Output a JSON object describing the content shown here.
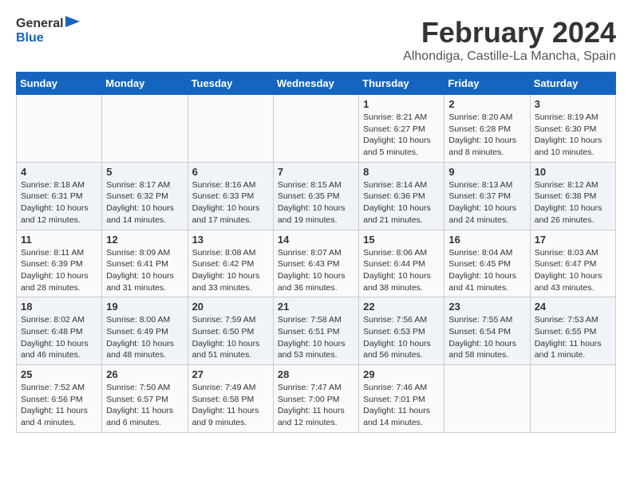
{
  "header": {
    "logo_line1": "General",
    "logo_line2": "Blue",
    "month": "February 2024",
    "location": "Alhondiga, Castille-La Mancha, Spain"
  },
  "days_of_week": [
    "Sunday",
    "Monday",
    "Tuesday",
    "Wednesday",
    "Thursday",
    "Friday",
    "Saturday"
  ],
  "weeks": [
    [
      {
        "day": "",
        "detail": ""
      },
      {
        "day": "",
        "detail": ""
      },
      {
        "day": "",
        "detail": ""
      },
      {
        "day": "",
        "detail": ""
      },
      {
        "day": "1",
        "detail": "Sunrise: 8:21 AM\nSunset: 6:27 PM\nDaylight: 10 hours\nand 5 minutes."
      },
      {
        "day": "2",
        "detail": "Sunrise: 8:20 AM\nSunset: 6:28 PM\nDaylight: 10 hours\nand 8 minutes."
      },
      {
        "day": "3",
        "detail": "Sunrise: 8:19 AM\nSunset: 6:30 PM\nDaylight: 10 hours\nand 10 minutes."
      }
    ],
    [
      {
        "day": "4",
        "detail": "Sunrise: 8:18 AM\nSunset: 6:31 PM\nDaylight: 10 hours\nand 12 minutes."
      },
      {
        "day": "5",
        "detail": "Sunrise: 8:17 AM\nSunset: 6:32 PM\nDaylight: 10 hours\nand 14 minutes."
      },
      {
        "day": "6",
        "detail": "Sunrise: 8:16 AM\nSunset: 6:33 PM\nDaylight: 10 hours\nand 17 minutes."
      },
      {
        "day": "7",
        "detail": "Sunrise: 8:15 AM\nSunset: 6:35 PM\nDaylight: 10 hours\nand 19 minutes."
      },
      {
        "day": "8",
        "detail": "Sunrise: 8:14 AM\nSunset: 6:36 PM\nDaylight: 10 hours\nand 21 minutes."
      },
      {
        "day": "9",
        "detail": "Sunrise: 8:13 AM\nSunset: 6:37 PM\nDaylight: 10 hours\nand 24 minutes."
      },
      {
        "day": "10",
        "detail": "Sunrise: 8:12 AM\nSunset: 6:38 PM\nDaylight: 10 hours\nand 26 minutes."
      }
    ],
    [
      {
        "day": "11",
        "detail": "Sunrise: 8:11 AM\nSunset: 6:39 PM\nDaylight: 10 hours\nand 28 minutes."
      },
      {
        "day": "12",
        "detail": "Sunrise: 8:09 AM\nSunset: 6:41 PM\nDaylight: 10 hours\nand 31 minutes."
      },
      {
        "day": "13",
        "detail": "Sunrise: 8:08 AM\nSunset: 6:42 PM\nDaylight: 10 hours\nand 33 minutes."
      },
      {
        "day": "14",
        "detail": "Sunrise: 8:07 AM\nSunset: 6:43 PM\nDaylight: 10 hours\nand 36 minutes."
      },
      {
        "day": "15",
        "detail": "Sunrise: 8:06 AM\nSunset: 6:44 PM\nDaylight: 10 hours\nand 38 minutes."
      },
      {
        "day": "16",
        "detail": "Sunrise: 8:04 AM\nSunset: 6:45 PM\nDaylight: 10 hours\nand 41 minutes."
      },
      {
        "day": "17",
        "detail": "Sunrise: 8:03 AM\nSunset: 6:47 PM\nDaylight: 10 hours\nand 43 minutes."
      }
    ],
    [
      {
        "day": "18",
        "detail": "Sunrise: 8:02 AM\nSunset: 6:48 PM\nDaylight: 10 hours\nand 46 minutes."
      },
      {
        "day": "19",
        "detail": "Sunrise: 8:00 AM\nSunset: 6:49 PM\nDaylight: 10 hours\nand 48 minutes."
      },
      {
        "day": "20",
        "detail": "Sunrise: 7:59 AM\nSunset: 6:50 PM\nDaylight: 10 hours\nand 51 minutes."
      },
      {
        "day": "21",
        "detail": "Sunrise: 7:58 AM\nSunset: 6:51 PM\nDaylight: 10 hours\nand 53 minutes."
      },
      {
        "day": "22",
        "detail": "Sunrise: 7:56 AM\nSunset: 6:53 PM\nDaylight: 10 hours\nand 56 minutes."
      },
      {
        "day": "23",
        "detail": "Sunrise: 7:55 AM\nSunset: 6:54 PM\nDaylight: 10 hours\nand 58 minutes."
      },
      {
        "day": "24",
        "detail": "Sunrise: 7:53 AM\nSunset: 6:55 PM\nDaylight: 11 hours\nand 1 minute."
      }
    ],
    [
      {
        "day": "25",
        "detail": "Sunrise: 7:52 AM\nSunset: 6:56 PM\nDaylight: 11 hours\nand 4 minutes."
      },
      {
        "day": "26",
        "detail": "Sunrise: 7:50 AM\nSunset: 6:57 PM\nDaylight: 11 hours\nand 6 minutes."
      },
      {
        "day": "27",
        "detail": "Sunrise: 7:49 AM\nSunset: 6:58 PM\nDaylight: 11 hours\nand 9 minutes."
      },
      {
        "day": "28",
        "detail": "Sunrise: 7:47 AM\nSunset: 7:00 PM\nDaylight: 11 hours\nand 12 minutes."
      },
      {
        "day": "29",
        "detail": "Sunrise: 7:46 AM\nSunset: 7:01 PM\nDaylight: 11 hours\nand 14 minutes."
      },
      {
        "day": "",
        "detail": ""
      },
      {
        "day": "",
        "detail": ""
      }
    ]
  ]
}
